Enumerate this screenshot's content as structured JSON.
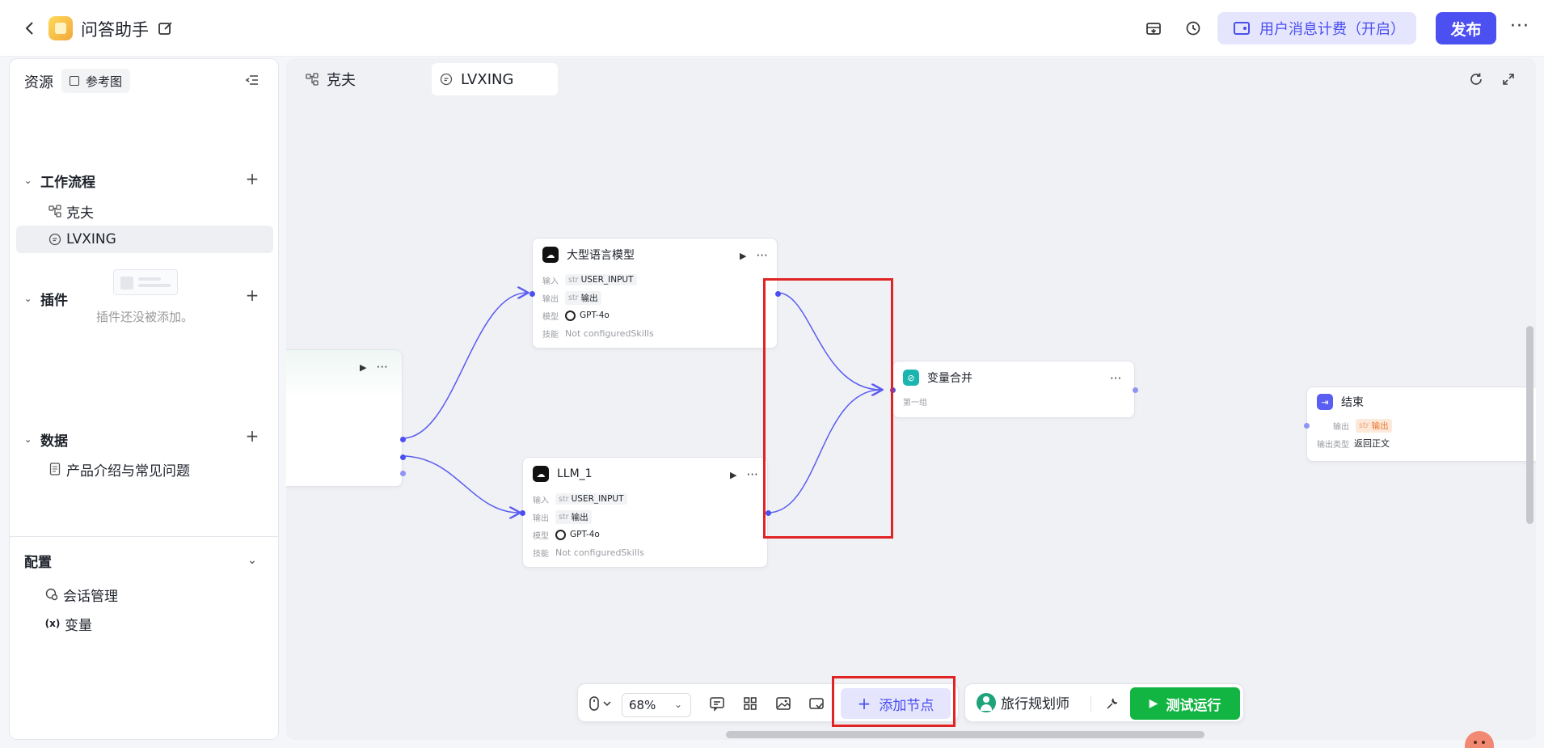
{
  "header": {
    "app_title": "问答助手",
    "billing_label": "用户消息计费（开启）",
    "publish_label": "发布",
    "more_label": "···"
  },
  "sidebar": {
    "title": "资源",
    "ref_button": "参考图",
    "workflow": {
      "title": "工作流程",
      "items": [
        "克夫",
        "LVXING"
      ]
    },
    "plugin": {
      "title": "插件",
      "empty_text": "插件还没被添加。"
    },
    "data": {
      "title": "数据",
      "items": [
        "产品介绍与常见问题"
      ]
    },
    "config": {
      "title": "配置",
      "items": [
        "会话管理",
        "变量"
      ]
    }
  },
  "canvas": {
    "tabs": [
      "克夫",
      "LVXING"
    ],
    "active_tab": "LVXING",
    "nodes": {
      "llm_top": {
        "title": "大型语言模型",
        "input_label": "输入",
        "input_type": "str",
        "input_value": "USER_INPUT",
        "output_label": "输出",
        "output_type": "str",
        "output_value": "输出",
        "model_label": "模型",
        "model_value": "GPT-4o",
        "skill_label": "技能",
        "skill_value": "Not configuredSkills"
      },
      "llm_1": {
        "title": "LLM_1",
        "input_label": "输入",
        "input_type": "str",
        "input_value": "USER_INPUT",
        "output_label": "输出",
        "output_type": "str",
        "output_value": "输出",
        "model_label": "模型",
        "model_value": "GPT-4o",
        "skill_label": "技能",
        "skill_value": "Not configuredSkills"
      },
      "merge": {
        "title": "变量合并",
        "group": "第一组"
      },
      "end": {
        "title": "结束",
        "output_label": "输出",
        "output_type": "str",
        "output_value": "输出",
        "output_type_label": "输出类型",
        "output_type_value": "返回正文"
      }
    }
  },
  "toolbar": {
    "zoom": "68%",
    "add_node": "添加节点",
    "persona": "旅行规划师",
    "test_run": "测试运行"
  },
  "colors": {
    "accent": "#4d50f0",
    "accent_light": "#e5e6fd",
    "run_green": "#12b442",
    "highlight_red": "#e02424"
  }
}
